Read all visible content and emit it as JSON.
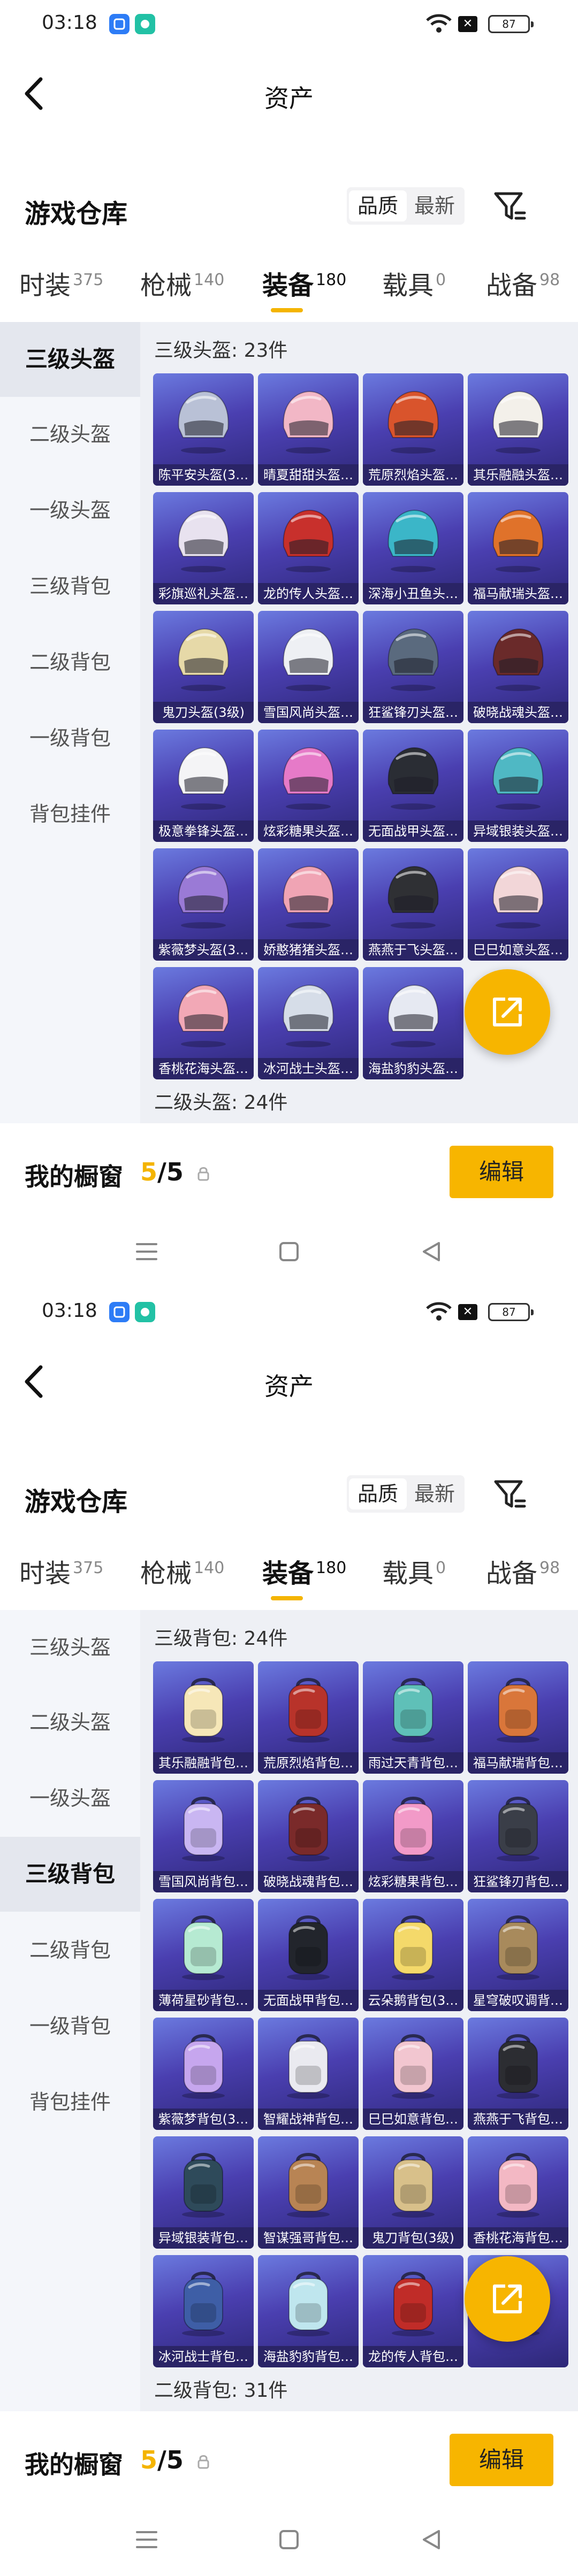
{
  "status": {
    "time": "03:18",
    "battery": "87"
  },
  "nav": {
    "title": "资产"
  },
  "warehouse": {
    "title": "游戏仓库",
    "sort_options": [
      "品质",
      "最新"
    ]
  },
  "tabs": [
    {
      "label": "时装",
      "count": "375"
    },
    {
      "label": "枪械",
      "count": "140"
    },
    {
      "label": "装备",
      "count": "180"
    },
    {
      "label": "载具",
      "count": "0"
    },
    {
      "label": "战备",
      "count": "98"
    }
  ],
  "screens": [
    {
      "active_side": 0,
      "side_items": [
        "三级头盔",
        "二级头盔",
        "一级头盔",
        "三级背包",
        "二级背包",
        "一级背包",
        "背包挂件"
      ],
      "section_title": "三级头盔: 23件",
      "next_section_title": "二级头盔: 24件",
      "items": [
        {
          "label": "陈平安头盔(3…",
          "color": "#b9c1d6",
          "icon": "helmet-icon"
        },
        {
          "label": "晴夏甜甜头盔…",
          "color": "#f2b7c6",
          "icon": "helmet-icon"
        },
        {
          "label": "荒原烈焰头盔…",
          "color": "#d9542c",
          "icon": "helmet-icon"
        },
        {
          "label": "其乐融融头盔…",
          "color": "#f3f0ea",
          "icon": "helmet-icon"
        },
        {
          "label": "彩旗巡礼头盔…",
          "color": "#e8e2ef",
          "icon": "helmet-icon"
        },
        {
          "label": "龙的传人头盔…",
          "color": "#c8302c",
          "icon": "helmet-icon"
        },
        {
          "label": "深海小丑鱼头…",
          "color": "#3bb6c8",
          "icon": "helmet-icon"
        },
        {
          "label": "福马献瑞头盔…",
          "color": "#e0722a",
          "icon": "helmet-icon"
        },
        {
          "label": "鬼刀头盔(3级)",
          "color": "#e6d9a8",
          "icon": "helmet-icon"
        },
        {
          "label": "雪国风尚头盔…",
          "color": "#eef0f4",
          "icon": "helmet-icon"
        },
        {
          "label": "狂鲨锋刃头盔…",
          "color": "#5a6a7e",
          "icon": "helmet-icon"
        },
        {
          "label": "破晓战魂头盔…",
          "color": "#6a2a2a",
          "icon": "helmet-icon"
        },
        {
          "label": "极意拳锋头盔…",
          "color": "#f4f4f6",
          "icon": "helmet-icon"
        },
        {
          "label": "炫彩糖果头盔…",
          "color": "#e67ac8",
          "icon": "helmet-icon"
        },
        {
          "label": "无面战甲头盔…",
          "color": "#2a2d34",
          "icon": "helmet-icon"
        },
        {
          "label": "异域银装头盔…",
          "color": "#4fb8c4",
          "icon": "helmet-icon"
        },
        {
          "label": "紫薇梦头盔(3…",
          "color": "#9a7ad6",
          "icon": "helmet-icon"
        },
        {
          "label": "娇憨猪猪头盔…",
          "color": "#f0a4b4",
          "icon": "helmet-icon"
        },
        {
          "label": "燕燕于飞头盔…",
          "color": "#2f3034",
          "icon": "helmet-icon"
        },
        {
          "label": "巳巳如意头盔…",
          "color": "#f2d6d8",
          "icon": "helmet-icon"
        },
        {
          "label": "香桃花海头盔…",
          "color": "#f2a8b6",
          "icon": "helmet-icon"
        },
        {
          "label": "冰河战士头盔…",
          "color": "#d6dde8",
          "icon": "helmet-icon"
        },
        {
          "label": "海盐豹豹头盔…",
          "color": "#e6e9f2",
          "icon": "helmet-icon"
        }
      ],
      "showcase": {
        "title": "我的橱窗",
        "current": "5",
        "total": "/5",
        "edit_label": "编辑"
      }
    },
    {
      "active_side": 3,
      "side_items": [
        "三级头盔",
        "二级头盔",
        "一级头盔",
        "三级背包",
        "二级背包",
        "一级背包",
        "背包挂件"
      ],
      "section_title": "三级背包: 24件",
      "next_section_title": "二级背包: 31件",
      "items": [
        {
          "label": "其乐融融背包…",
          "color": "#f6e7b8",
          "icon": "backpack-icon"
        },
        {
          "label": "荒原烈焰背包…",
          "color": "#b8332a",
          "icon": "backpack-icon"
        },
        {
          "label": "雨过天青背包…",
          "color": "#5fc0b8",
          "icon": "backpack-icon"
        },
        {
          "label": "福马献瑞背包…",
          "color": "#d9763a",
          "icon": "backpack-icon"
        },
        {
          "label": "雪国风尚背包…",
          "color": "#c9b6f2",
          "icon": "backpack-icon"
        },
        {
          "label": "破晓战魂背包…",
          "color": "#7a2a2a",
          "icon": "backpack-icon"
        },
        {
          "label": "炫彩糖果背包…",
          "color": "#f29ac8",
          "icon": "backpack-icon"
        },
        {
          "label": "狂鲨锋刃背包…",
          "color": "#3a3e48",
          "icon": "backpack-icon"
        },
        {
          "label": "薄荷星砂背包…",
          "color": "#b6ead2",
          "icon": "backpack-icon"
        },
        {
          "label": "无面战甲背包…",
          "color": "#22252c",
          "icon": "backpack-icon"
        },
        {
          "label": "云朵鹅背包(3…",
          "color": "#f4d96a",
          "icon": "backpack-icon"
        },
        {
          "label": "星穹破叹调背…",
          "color": "#a88a5c",
          "icon": "backpack-icon"
        },
        {
          "label": "紫薇梦背包(3…",
          "color": "#c6a6ee",
          "icon": "backpack-icon"
        },
        {
          "label": "智耀战神背包…",
          "color": "#eaeaf0",
          "icon": "backpack-icon"
        },
        {
          "label": "巳巳如意背包…",
          "color": "#f2c6d0",
          "icon": "backpack-icon"
        },
        {
          "label": "燕燕于飞背包…",
          "color": "#2c2d32",
          "icon": "backpack-icon"
        },
        {
          "label": "异域银装背包…",
          "color": "#2e4a5a",
          "icon": "backpack-icon"
        },
        {
          "label": "智谋强哥背包…",
          "color": "#b88454",
          "icon": "backpack-icon"
        },
        {
          "label": "鬼刀背包(3级)",
          "color": "#d8c08a",
          "icon": "backpack-icon"
        },
        {
          "label": "香桃花海背包…",
          "color": "#f3b8c4",
          "icon": "backpack-icon"
        },
        {
          "label": "冰河战士背包…",
          "color": "#3e5ea6",
          "icon": "backpack-icon"
        },
        {
          "label": "海盐豹豹背包…",
          "color": "#bfe6ee",
          "icon": "backpack-icon"
        },
        {
          "label": "龙的传人背包…",
          "color": "#c02c28",
          "icon": "backpack-icon"
        },
        {
          "label": "",
          "color": "#e9e2d2",
          "icon": "backpack-icon"
        }
      ],
      "showcase": {
        "title": "我的橱窗",
        "current": "5",
        "total": "/5",
        "edit_label": "编辑"
      }
    }
  ]
}
